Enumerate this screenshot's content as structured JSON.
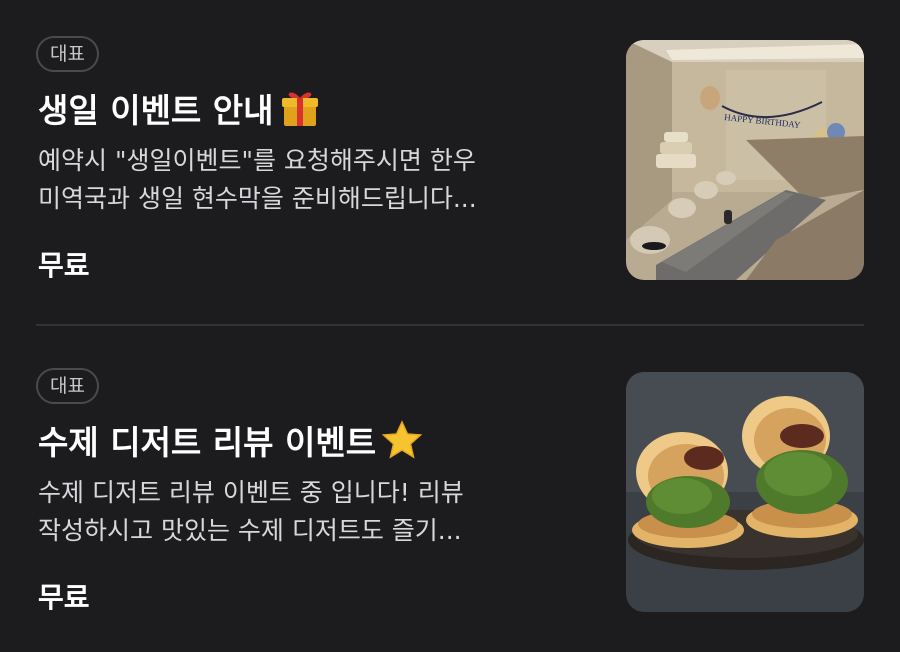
{
  "items": [
    {
      "badge": "대표",
      "title": "생일 이벤트 안내",
      "emoji_icon": "gift-icon",
      "description_line1": "예약시 \"생일이벤트\"를 요청해주시면 한우",
      "description_line2": "미역국과 생일 현수막을 준비해드립니다...",
      "price": "무료",
      "banner_text": "HAPPY BIRTHDAY"
    },
    {
      "badge": "대표",
      "title": "수제 디저트 리뷰 이벤트",
      "emoji_icon": "star-icon",
      "description_line1": "수제 디저트 리뷰 이벤트 중 입니다! 리뷰",
      "description_line2": "작성하시고 맛있는 수제 디저트도 즐기...",
      "price": "무료"
    }
  ]
}
